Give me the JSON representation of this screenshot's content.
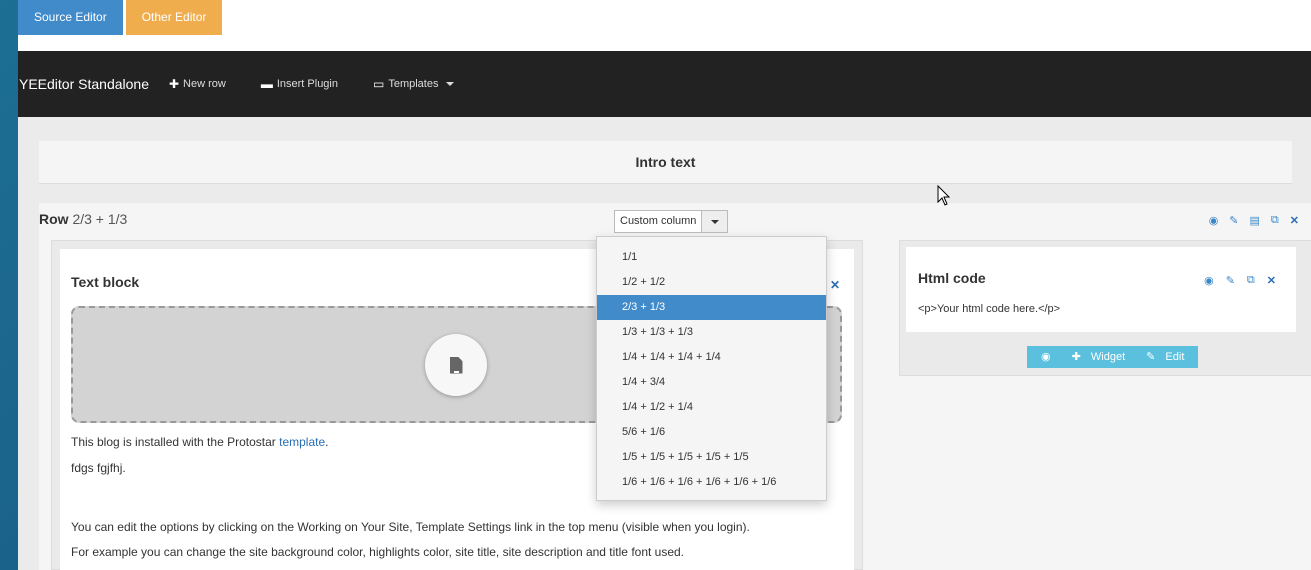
{
  "tabs": {
    "source": "Source Editor",
    "other": "Other Editor"
  },
  "navbar": {
    "brand": "YEEditor Standalone",
    "new_row": "New row",
    "insert_plugin": "Insert Plugin",
    "templates": "Templates"
  },
  "intro": {
    "title": "Intro text"
  },
  "row": {
    "title": "Row",
    "layout": "2/3 + 1/3",
    "column_select": "Custom column"
  },
  "dropdown": {
    "options": [
      "1/1",
      "1/2 + 1/2",
      "2/3 + 1/3",
      "1/3 + 1/3 + 1/3",
      "1/4 + 1/4 + 1/4 + 1/4",
      "1/4 + 3/4",
      "1/4 + 1/2 + 1/4",
      "5/6 + 1/6",
      "1/5 + 1/5 + 1/5 + 1/5 + 1/5",
      "1/6 + 1/6 + 1/6 + 1/6 + 1/6 + 1/6"
    ],
    "selected": "2/3 + 1/3"
  },
  "text_block": {
    "title": "Text block",
    "para1_prefix": "This blog is installed with the Protostar ",
    "para1_link": "template",
    "para1_suffix": ".",
    "para2": "fdgs fgjfhj.",
    "para3": "You can edit the options by clicking on the Working on Your Site, Template Settings link in the top menu (visible when you login).",
    "para4": "For example you can change the site background color, highlights color, site title, site description and title font used."
  },
  "html_block": {
    "title": "Html code",
    "code": "<p>Your html code here.</p>",
    "widget_label": "Widget",
    "edit_label": "Edit"
  },
  "icons": {
    "preview": "eye-icon",
    "edit": "edit-icon",
    "save": "file-icon",
    "copy": "copy-icon",
    "close": "close-icon"
  }
}
